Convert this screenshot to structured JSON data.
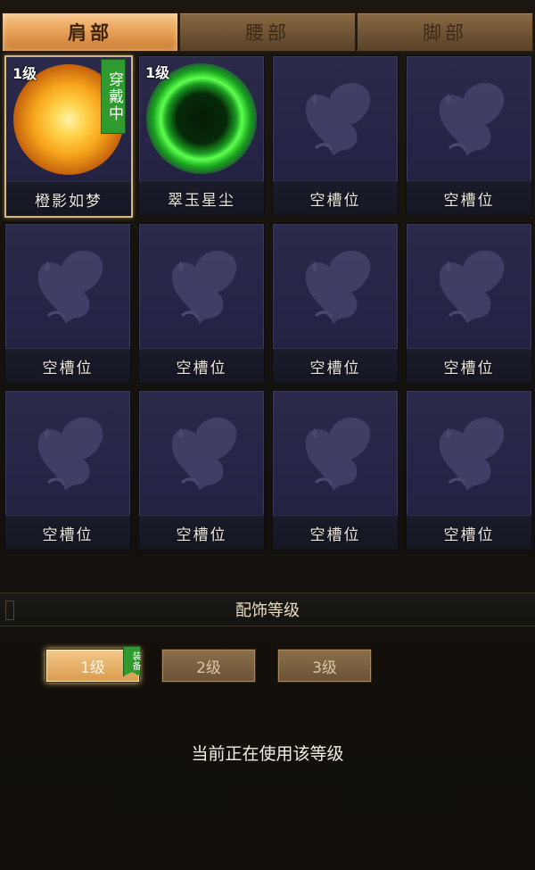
{
  "tabs": [
    {
      "label": "肩部",
      "active": true
    },
    {
      "label": "腰部",
      "active": false
    },
    {
      "label": "脚部",
      "active": false
    }
  ],
  "slots": [
    {
      "name": "橙影如梦",
      "level": "1级",
      "wearing": "穿戴中",
      "art": "golden-orb-icon",
      "selected": true
    },
    {
      "name": "翠玉星尘",
      "level": "1级",
      "art": "green-orb-icon"
    },
    {
      "name": "空槽位",
      "art": "butterfly-icon"
    },
    {
      "name": "空槽位",
      "art": "butterfly-icon"
    },
    {
      "name": "空槽位",
      "art": "butterfly-icon"
    },
    {
      "name": "空槽位",
      "art": "butterfly-icon"
    },
    {
      "name": "空槽位",
      "art": "butterfly-icon"
    },
    {
      "name": "空槽位",
      "art": "butterfly-icon"
    },
    {
      "name": "空槽位",
      "art": "butterfly-icon"
    },
    {
      "name": "空槽位",
      "art": "butterfly-icon"
    },
    {
      "name": "空槽位",
      "art": "butterfly-icon"
    },
    {
      "name": "空槽位",
      "art": "butterfly-icon"
    }
  ],
  "level_section": {
    "title": "配饰等级",
    "buttons": [
      "1级",
      "2级",
      "3级"
    ],
    "active_index": 0,
    "equipped_flag": "装备",
    "status": "当前正在使用该等级"
  },
  "colors": {
    "accent_orange": "#e8a35a",
    "wear_green": "#2f9a2e",
    "slot_bg": "#2c2a4a"
  }
}
